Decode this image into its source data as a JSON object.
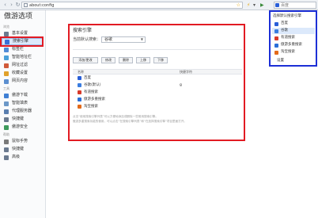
{
  "browser": {
    "back_icon": "back-arrow-icon",
    "forward_icon": "forward-arrow-icon",
    "reload_icon": "reload-icon",
    "url": "about:config",
    "search_placeholder": "百度",
    "lightning_glyph": "⚡",
    "dropdown_glyph": "▾",
    "go_glyph": "▶"
  },
  "sidebar": {
    "title": "傲游选项",
    "sections": [
      {
        "label": "浏览"
      },
      {
        "label": "工具"
      },
      {
        "label": "帮助"
      }
    ],
    "items": [
      {
        "label": "基本设置",
        "icon": "settings-icon",
        "color": "#6b7a8f"
      },
      {
        "label": "搜索引擎",
        "icon": "search-icon",
        "color": "#3a6fd8"
      },
      {
        "label": "标签栏",
        "icon": "tab-icon",
        "color": "#4f8bd6"
      },
      {
        "label": "智能地址栏",
        "icon": "address-bar-icon",
        "color": "#4aa0d9"
      },
      {
        "label": "网址过滤",
        "icon": "filter-icon",
        "color": "#d05a3a"
      },
      {
        "label": "收藏设置",
        "icon": "favorites-icon",
        "color": "#e0a12b"
      },
      {
        "label": "网页内容",
        "icon": "web-content-icon",
        "color": "#5c8fd0"
      },
      {
        "label": "傲游下载",
        "icon": "download-icon",
        "color": "#3f7fd4"
      },
      {
        "label": "智能填表",
        "icon": "form-fill-icon",
        "color": "#6b98c8"
      },
      {
        "label": "代理服务器",
        "icon": "proxy-icon",
        "color": "#5a7fb0"
      },
      {
        "label": "快捷键",
        "icon": "keyboard-icon",
        "color": "#6b7a8f"
      },
      {
        "label": "傲游安全",
        "icon": "security-icon",
        "color": "#3d9a5c"
      },
      {
        "label": "鼠标手势",
        "icon": "mouse-gesture-icon",
        "color": "#7a7a7a"
      },
      {
        "label": "快捷键",
        "icon": "shortcut-icon",
        "color": "#6b7a8f"
      },
      {
        "label": "高级",
        "icon": "advanced-icon",
        "color": "#6b7a8f"
      }
    ]
  },
  "main": {
    "title": "搜索引擎",
    "default_label": "当前默认搜索：",
    "default_value": "谷歌",
    "buttons": [
      "添加/更改",
      "修改",
      "删除",
      "上移",
      "下移"
    ],
    "columns": [
      "名称",
      "快捷字符"
    ],
    "engines": [
      {
        "name": "百度",
        "key": "",
        "icon": "baidu-icon",
        "color": "#2a5fd8"
      },
      {
        "name": "谷歌(默认)",
        "key": "g",
        "icon": "google-icon",
        "color": "#3a7de0"
      },
      {
        "name": "有道搜索",
        "key": "",
        "icon": "youdao-icon",
        "color": "#d83a2a"
      },
      {
        "name": "傲游多重搜索",
        "key": "",
        "icon": "maxthon-multi-search-icon",
        "color": "#2a6fd8"
      },
      {
        "name": "淘宝搜索",
        "key": "",
        "icon": "taobao-icon",
        "color": "#e36a1a"
      }
    ],
    "notes": [
      "点击“使用搜索引擎列表”可以方便地添加或删除一些常用搜索引擎。",
      "傲游多重搜索功能的使用，可以点击“在搜索引擎列表”和“在选择搜索引擎”项目里面打开。"
    ]
  },
  "popup": {
    "title": "选择默认搜索引擎",
    "items": [
      {
        "label": "百度",
        "icon": "baidu-icon",
        "color": "#2a5fd8"
      },
      {
        "label": "谷歌",
        "icon": "google-icon",
        "color": "#3a7de0"
      },
      {
        "label": "有道搜索",
        "icon": "youdao-icon",
        "color": "#d83a2a"
      },
      {
        "label": "傲游多重搜索",
        "icon": "maxthon-multi-search-icon",
        "color": "#2a6fd8"
      },
      {
        "label": "淘宝搜索",
        "icon": "taobao-icon",
        "color": "#e36a1a"
      }
    ],
    "settings_label": "设置"
  },
  "colors": {
    "highlight_red": "#e21b23",
    "highlight_blue": "#1c2fd6",
    "selection": "#dce9fb"
  }
}
